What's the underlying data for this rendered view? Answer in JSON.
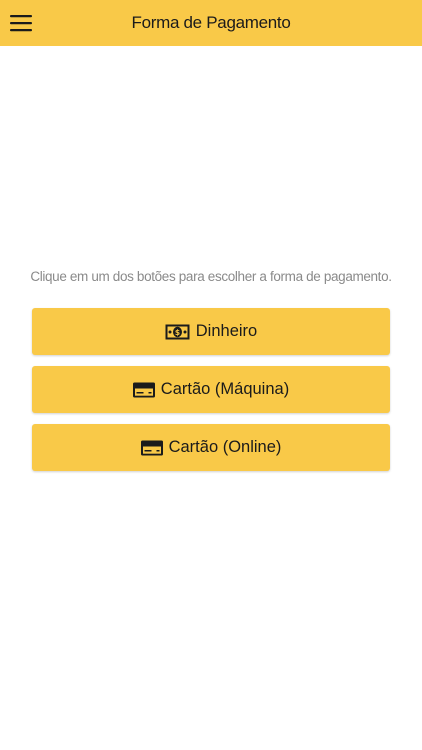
{
  "header": {
    "title": "Forma de Pagamento",
    "menu_icon": "hamburger-menu-icon"
  },
  "main": {
    "instruction": "Clique em um dos botões para escolher a forma de pagamento.",
    "buttons": [
      {
        "label": "Dinheiro",
        "icon": "cash-icon"
      },
      {
        "label": "Cartão (Máquina)",
        "icon": "credit-card-icon"
      },
      {
        "label": "Cartão (Online)",
        "icon": "credit-card-icon"
      }
    ]
  },
  "colors": {
    "accent": "#f9c948",
    "text": "#1b1b1b",
    "muted_text": "#8a8a8a",
    "background": "#ffffff"
  }
}
